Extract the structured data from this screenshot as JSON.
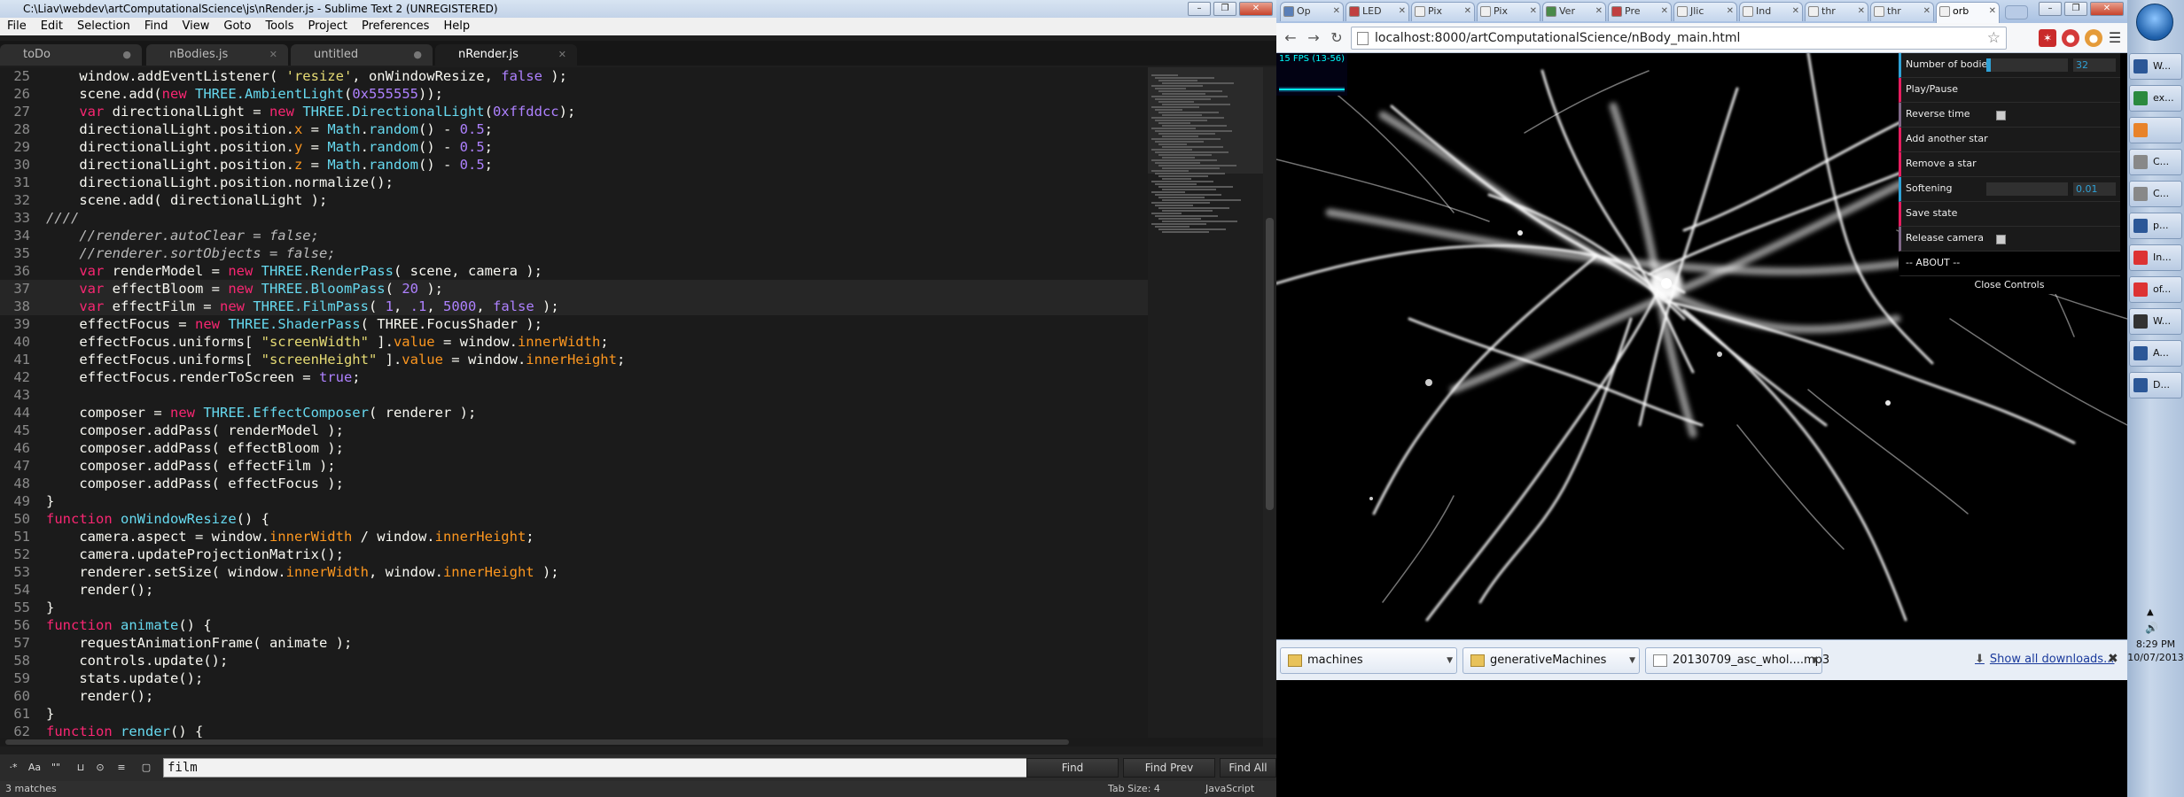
{
  "sublime": {
    "title": "C:\\Liav\\webdev\\artComputationalScience\\js\\nRender.js - Sublime Text 2 (UNREGISTERED)",
    "menu": [
      "File",
      "Edit",
      "Selection",
      "Find",
      "View",
      "Goto",
      "Tools",
      "Project",
      "Preferences",
      "Help"
    ],
    "tabs": [
      "toDo",
      "nBodies.js",
      "untitled",
      "nRender.js"
    ],
    "active_tab": "nRender.js",
    "lines": [
      {
        "n": "25",
        "html": "    window.addEventListener( <span class=\"str\">'resize'</span>, onWindowResize, <span class=\"num\">false</span> );"
      },
      {
        "n": "26",
        "html": "    scene.add(<span class=\"kw\">new</span> <span class=\"fn\">THREE.AmbientLight</span>(<span class=\"num\">0x555555</span>));"
      },
      {
        "n": "27",
        "html": "    <span class=\"kw\">var</span> directionalLight = <span class=\"kw\">new</span> <span class=\"fn\">THREE.DirectionalLight</span>(<span class=\"num\">0xffddcc</span>);"
      },
      {
        "n": "28",
        "html": "    directionalLight.position.<span class=\"prop\">x</span> = <span class=\"fn\">Math</span>.<span class=\"fn\">random</span>() - <span class=\"num\">0.5</span>;"
      },
      {
        "n": "29",
        "html": "    directionalLight.position.<span class=\"prop\">y</span> = <span class=\"fn\">Math</span>.<span class=\"fn\">random</span>() - <span class=\"num\">0.5</span>;"
      },
      {
        "n": "30",
        "html": "    directionalLight.position.<span class=\"prop\">z</span> = <span class=\"fn\">Math</span>.<span class=\"fn\">random</span>() - <span class=\"num\">0.5</span>;"
      },
      {
        "n": "31",
        "html": "    directionalLight.position.normalize();"
      },
      {
        "n": "32",
        "html": "    scene.add( directionalLight );"
      },
      {
        "n": "33",
        "html": "<span class=\"cm\">////</span>"
      },
      {
        "n": "34",
        "html": "    <span class=\"cm\">//renderer.autoClear = false;</span>"
      },
      {
        "n": "35",
        "html": "    <span class=\"cm\">//renderer.sortObjects = false;</span>"
      },
      {
        "n": "36",
        "html": "    <span class=\"kw\">var</span> renderModel = <span class=\"kw\">new</span> <span class=\"fn\">THREE.RenderPass</span>( scene, camera );"
      },
      {
        "n": "37",
        "html": "    <span class=\"kw\">var</span> effectBloom = <span class=\"kw\">new</span> <span class=\"fn\">THREE.BloomPass</span>( <span class=\"num\">20</span> );"
      },
      {
        "n": "38",
        "html": "    <span class=\"kw\">var</span> effectFilm = <span class=\"kw\">new</span> <span class=\"fn\">THREE.FilmPass</span>( <span class=\"num\">1</span>, <span class=\"num\">.1</span>, <span class=\"num\">5000</span>, <span class=\"num\">false</span> );"
      },
      {
        "n": "39",
        "html": "    effectFocus = <span class=\"kw\">new</span> <span class=\"fn\">THREE.ShaderPass</span>( THREE.FocusShader );"
      },
      {
        "n": "40",
        "html": "    effectFocus.uniforms[ <span class=\"str\">\"screenWidth\"</span> ].<span class=\"prop\">value</span> = window.<span class=\"prop\">innerWidth</span>;"
      },
      {
        "n": "41",
        "html": "    effectFocus.uniforms[ <span class=\"str\">\"screenHeight\"</span> ].<span class=\"prop\">value</span> = window.<span class=\"prop\">innerHeight</span>;"
      },
      {
        "n": "42",
        "html": "    effectFocus.renderToScreen = <span class=\"num\">true</span>;"
      },
      {
        "n": "43",
        "html": ""
      },
      {
        "n": "44",
        "html": "    composer = <span class=\"kw\">new</span> <span class=\"fn\">THREE.EffectComposer</span>( renderer );"
      },
      {
        "n": "45",
        "html": "    composer.addPass( renderModel );"
      },
      {
        "n": "46",
        "html": "    composer.addPass( effectBloom );"
      },
      {
        "n": "47",
        "html": "    composer.addPass( effectFilm );"
      },
      {
        "n": "48",
        "html": "    composer.addPass( effectFocus );"
      },
      {
        "n": "49",
        "html": "}"
      },
      {
        "n": "50",
        "html": "<span class=\"kw\">function</span> <span class=\"fn\">onWindowResize</span>() {"
      },
      {
        "n": "51",
        "html": "    camera.aspect = window.<span class=\"prop\">innerWidth</span> / window.<span class=\"prop\">innerHeight</span>;"
      },
      {
        "n": "52",
        "html": "    camera.updateProjectionMatrix();"
      },
      {
        "n": "53",
        "html": "    renderer.setSize( window.<span class=\"prop\">innerWidth</span>, window.<span class=\"prop\">innerHeight</span> );"
      },
      {
        "n": "54",
        "html": "    render();"
      },
      {
        "n": "55",
        "html": "}"
      },
      {
        "n": "56",
        "html": "<span class=\"kw\">function</span> <span class=\"fn\">animate</span>() {"
      },
      {
        "n": "57",
        "html": "    requestAnimationFrame( animate );"
      },
      {
        "n": "58",
        "html": "    controls.update();"
      },
      {
        "n": "59",
        "html": "    stats.update();"
      },
      {
        "n": "60",
        "html": "    render();"
      },
      {
        "n": "61",
        "html": "}"
      },
      {
        "n": "62",
        "html": "<span class=\"kw\">function</span> <span class=\"fn\">render</span>() {"
      }
    ],
    "find": {
      "value": "film",
      "buttons": [
        "Find",
        "Find Prev",
        "Find All"
      ],
      "toggles": [
        "·*",
        "Aa",
        "\"\"",
        "⊔",
        "⊙",
        "≡",
        "▢"
      ]
    },
    "status": {
      "left": "3 matches",
      "tab_size": "Tab Size: 4",
      "syntax": "JavaScript"
    }
  },
  "chrome": {
    "tabs": [
      {
        "label": "Op",
        "color": "#5a7fb8"
      },
      {
        "label": "LED",
        "color": "#c04040"
      },
      {
        "label": "Pix",
        "color": "#f0f0f0"
      },
      {
        "label": "Pix",
        "color": "#f0f0f0"
      },
      {
        "label": "Ver",
        "color": "#4a8a4a"
      },
      {
        "label": "Pre",
        "color": "#c04040"
      },
      {
        "label": "Jlic",
        "color": "#f0f0f0"
      },
      {
        "label": "Ind",
        "color": "#f0f0f0"
      },
      {
        "label": "thr",
        "color": "#f0f0f0"
      },
      {
        "label": "thr",
        "color": "#f0f0f0"
      },
      {
        "label": "orb",
        "color": "#f0f0f0"
      }
    ],
    "url": "localhost:8000/artComputationalScience/nBody_main.html",
    "fps": "15 FPS (13-56)",
    "gui": {
      "num_bodies_label": "Number of bodies",
      "num_bodies_value": "32",
      "num_bodies_fraction": 0.05,
      "play_pause": "Play/Pause",
      "reverse_time": "Reverse time",
      "add_star": "Add another star",
      "remove_star": "Remove a star",
      "softening_label": "Softening",
      "softening_value": "0.01",
      "softening_fraction": 0.0,
      "save_state": "Save state",
      "release_camera": "Release camera",
      "about": "-- ABOUT --",
      "close": "Close Controls"
    },
    "downloads": [
      "machines",
      "generativeMachines",
      "20130709_asc_whol....mp3"
    ],
    "show_all": "Show all downloads...",
    "colors": {
      "gui_number": "#2fa1d6",
      "gui_function": "#e61d5f",
      "gui_boolean": "#806787"
    }
  },
  "taskbar": {
    "items": [
      "W...",
      "ex...",
      "",
      "C...",
      "C...",
      "p...",
      "In...",
      "of...",
      "W...",
      "A...",
      "D..."
    ],
    "time": "8:29 PM",
    "date": "10/07/2013"
  }
}
